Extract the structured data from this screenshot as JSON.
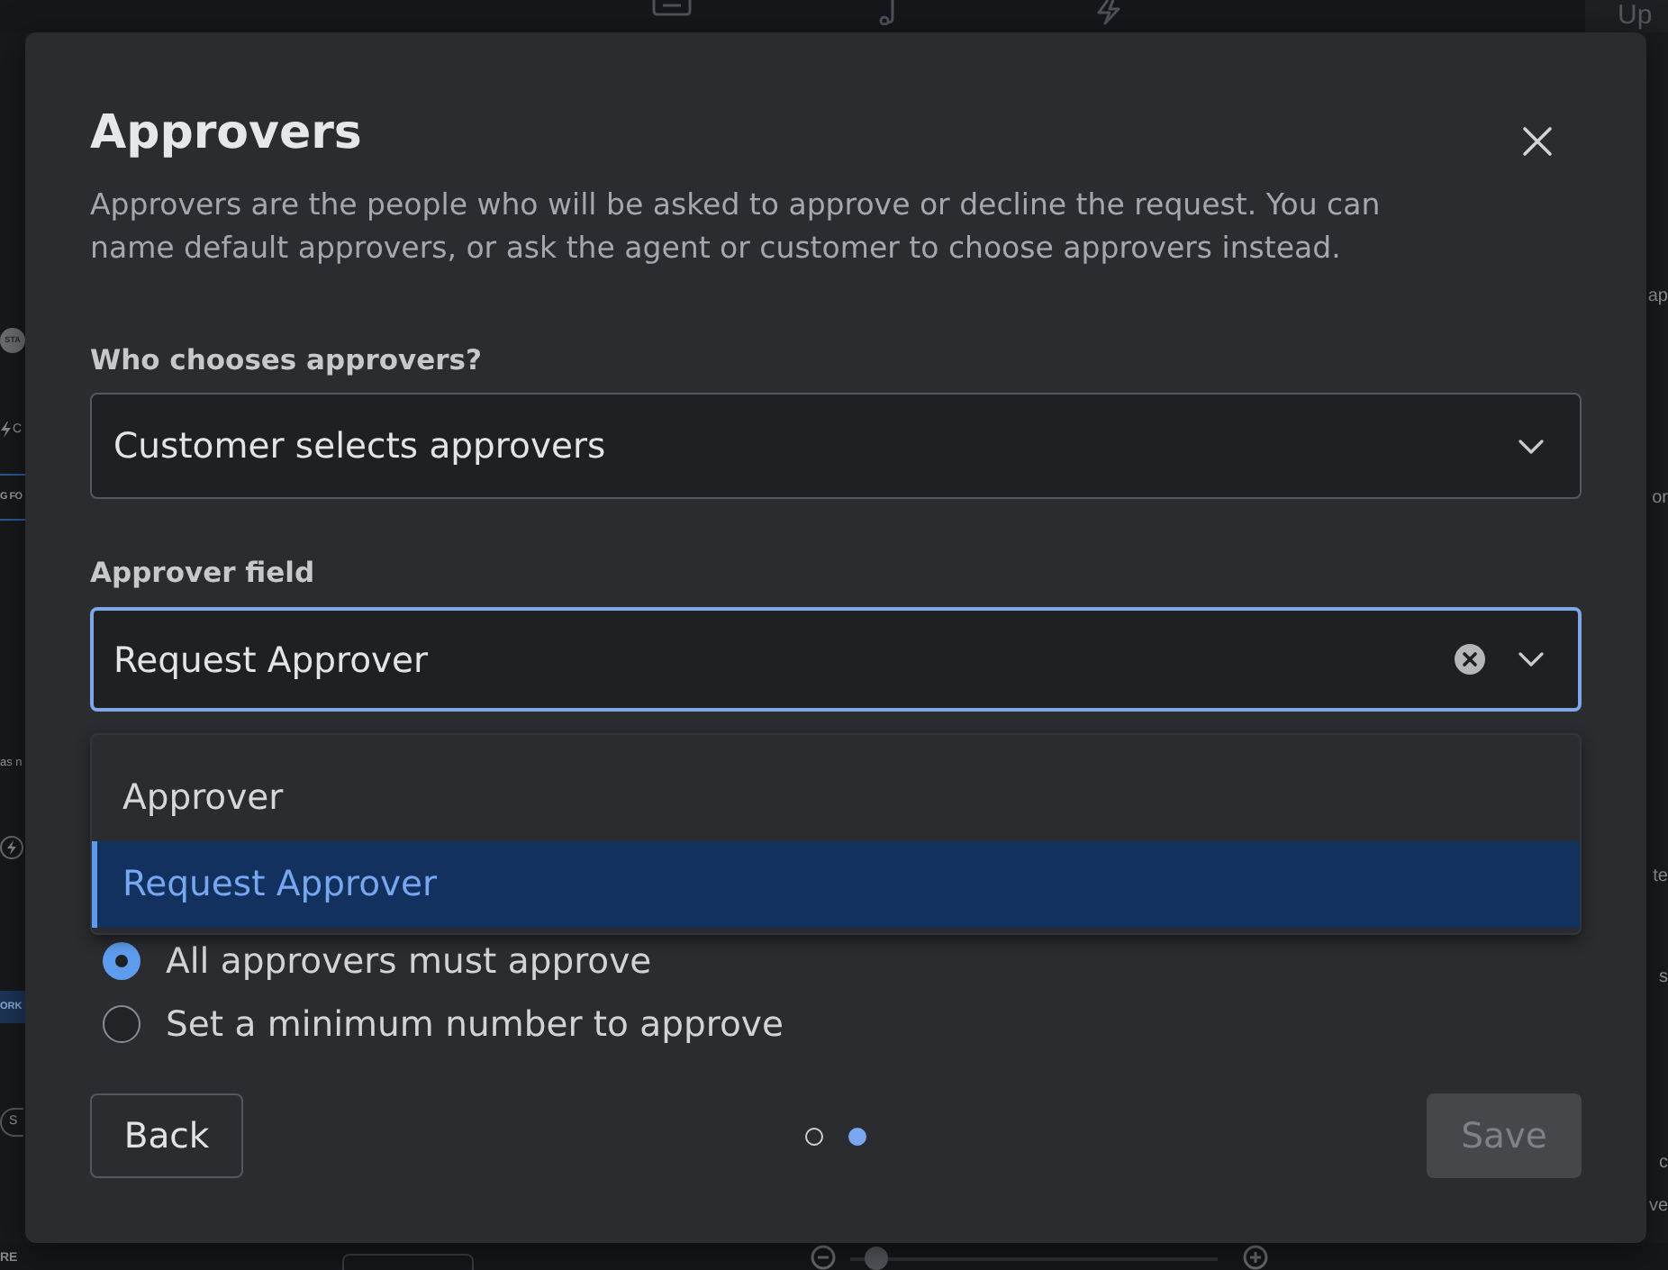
{
  "top_bar": {
    "button": "Up"
  },
  "sidebar": {
    "items": [
      {
        "kind": "avatar",
        "text": "STA"
      },
      {
        "kind": "action",
        "text": "C"
      },
      {
        "kind": "tab",
        "text": "G FO"
      },
      {
        "kind": "row",
        "text": "as n"
      },
      {
        "kind": "badge"
      },
      {
        "kind": "band",
        "text": "ORK"
      },
      {
        "kind": "pill",
        "text": "S"
      }
    ]
  },
  "side_panel": {
    "texts": [
      "ap",
      "or",
      "te",
      "s",
      "c",
      "ve"
    ]
  },
  "bottom_bar": {
    "text": "RE",
    "zoom_slider": {
      "level": 0.05
    }
  },
  "dialog": {
    "title": "Approvers",
    "description": "Approvers are the people who will be asked to approve or decline the request. You can name default approvers, or ask the agent or customer to choose approvers instead.",
    "fields": [
      {
        "label": "Who chooses approvers?",
        "value": "Customer selects approvers",
        "focused": false,
        "clearable": false
      },
      {
        "label": "Approver field",
        "value": "Request Approver",
        "focused": true,
        "clearable": true,
        "options": [
          {
            "label": "Approver",
            "selected": false
          },
          {
            "label": "Request Approver",
            "selected": true
          }
        ]
      }
    ],
    "radios": [
      {
        "label": "All approvers must approve",
        "selected": true
      },
      {
        "label": "Set a minimum number to approve",
        "selected": false
      }
    ],
    "back_button": {
      "label": "Back",
      "disabled": false
    },
    "steps": [
      {
        "selected": false
      },
      {
        "selected": true
      }
    ],
    "save_button": {
      "label": "Save",
      "disabled": true
    }
  }
}
